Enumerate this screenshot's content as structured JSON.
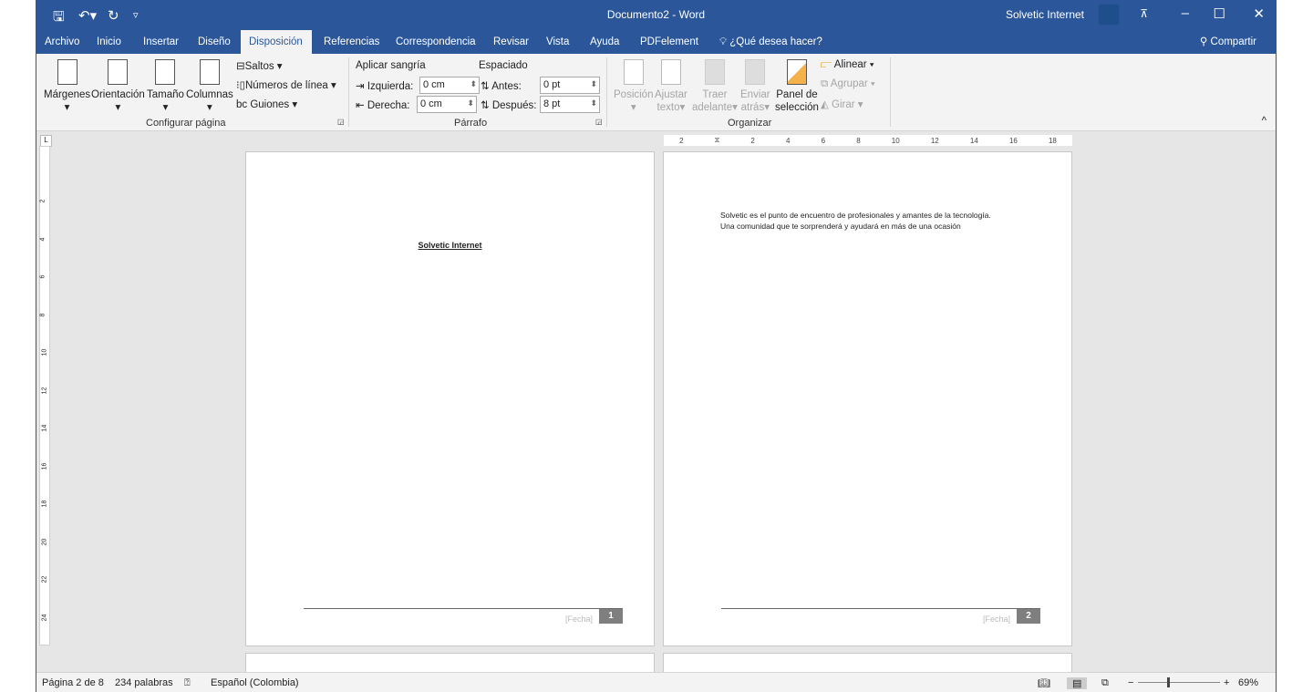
{
  "titlebar": {
    "document_title": "Documento2 - Word",
    "user": "Solvetic Internet"
  },
  "tabs": [
    "Archivo",
    "Inicio",
    "Insertar",
    "Diseño",
    "Disposición",
    "Referencias",
    "Correspondencia",
    "Revisar",
    "Vista",
    "Ayuda",
    "PDFelement"
  ],
  "active_tab": "Disposición",
  "tell_me": "¿Qué desea hacer?",
  "share": "Compartir",
  "ribbon": {
    "page_setup": {
      "margins": "Márgenes",
      "orientation": "Orientación",
      "size": "Tamaño",
      "columns": "Columnas",
      "breaks": "Saltos",
      "line_numbers": "Números de línea",
      "hyphenation": "Guiones",
      "group": "Configurar página"
    },
    "paragraph": {
      "indent": "Aplicar sangría",
      "left": "Izquierda:",
      "left_value": "0 cm",
      "right": "Derecha:",
      "right_value": "0 cm",
      "spacing": "Espaciado",
      "before": "Antes:",
      "before_value": "0 pt",
      "after": "Después:",
      "after_value": "8 pt",
      "group": "Párrafo"
    },
    "arrange": {
      "position": "Posición",
      "wrap1": "Ajustar",
      "wrap2": "texto",
      "forward1": "Traer",
      "forward2": "adelante",
      "backward1": "Enviar",
      "backward2": "atrás",
      "pane1": "Panel de",
      "pane2": "selección",
      "align": "Alinear",
      "group_btn": "Agrupar",
      "rotate": "Girar",
      "group": "Organizar"
    }
  },
  "ruler_labels": [
    "2",
    "",
    "2",
    "4",
    "6",
    "8",
    "10",
    "12",
    "14",
    "16",
    "18"
  ],
  "vruler_labels": [
    "2",
    "4",
    "6",
    "8",
    "10",
    "12",
    "14",
    "16",
    "18",
    "20",
    "22",
    "24"
  ],
  "pages": [
    {
      "heading": "Solvetic Internet",
      "footer_date": "[Fecha]",
      "number": "1"
    },
    {
      "line1": "Solvetic es el punto de encuentro de profesionales y amantes de la tecnología.",
      "line2": "Una comunidad que te sorprenderá y ayudará en más de una ocasión",
      "footer_date": "[Fecha]",
      "number": "2"
    }
  ],
  "status": {
    "page": "Página 2 de 8",
    "words": "234 palabras",
    "language": "Español (Colombia)",
    "zoom": "69%",
    "zoom_fraction": 0.35
  },
  "colors": {
    "accent": "#2b579a"
  }
}
